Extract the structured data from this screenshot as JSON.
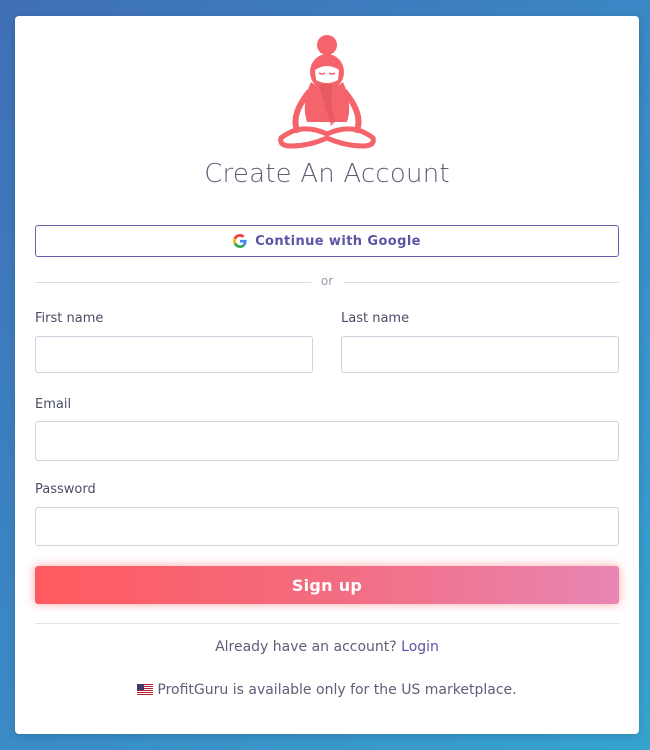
{
  "page": {
    "title": "Create An Account"
  },
  "logo": {
    "icon": "meditating-guru-logo-icon",
    "color": "#f5646a"
  },
  "google": {
    "label": "Continue with Google",
    "icon": "google-g-icon"
  },
  "divider": {
    "text": "or"
  },
  "form": {
    "first_name": {
      "label": "First name",
      "value": "",
      "placeholder": ""
    },
    "last_name": {
      "label": "Last name",
      "value": "",
      "placeholder": ""
    },
    "email": {
      "label": "Email",
      "value": "",
      "placeholder": ""
    },
    "password": {
      "label": "Password",
      "value": "",
      "placeholder": ""
    }
  },
  "signup": {
    "label": "Sign up"
  },
  "login": {
    "prompt": "Already have an account?",
    "link": "Login"
  },
  "notice": {
    "flag": "us-flag-icon",
    "text": "ProfitGuru is available only for the US marketplace."
  },
  "colors": {
    "accent": "#5a55a6",
    "brand": "#ff5a5f",
    "text": "#5c5f78"
  }
}
